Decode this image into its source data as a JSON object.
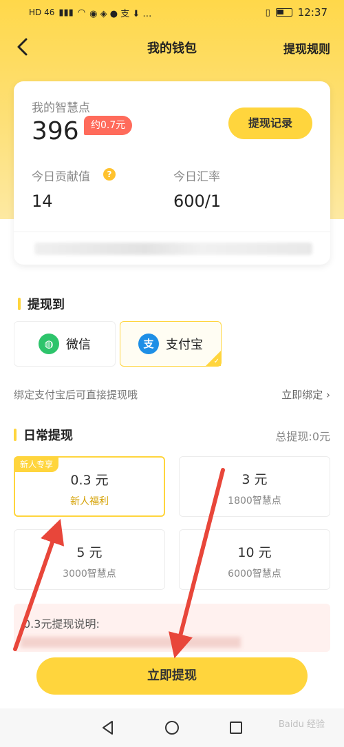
{
  "status_bar": {
    "left_text": "HD 46",
    "time": "12:37"
  },
  "nav": {
    "title": "我的钱包",
    "right_link": "提现规则"
  },
  "card": {
    "points_label": "我的智慧点",
    "points_value": "396",
    "approx_badge": "约0.7元",
    "record_button": "提现记录",
    "contrib_label": "今日贡献值",
    "contrib_value": "14",
    "rate_label": "今日汇率",
    "rate_value": "600/1"
  },
  "withdraw_to": {
    "title": "提现到",
    "options": [
      {
        "label": "微信",
        "icon": "wechat-icon"
      },
      {
        "label": "支付宝",
        "icon": "alipay-icon",
        "selected": true
      }
    ]
  },
  "bind": {
    "hint": "绑定支付宝后可直接提现哦",
    "link": "立即绑定"
  },
  "daily": {
    "title": "日常提现",
    "total": "总提现:0元",
    "amounts": [
      {
        "value": "0.3 元",
        "sub": "新人福利",
        "tag": "新人专享",
        "selected": true
      },
      {
        "value": "3 元",
        "sub": "1800智慧点"
      },
      {
        "value": "5 元",
        "sub": "3000智慧点"
      },
      {
        "value": "10 元",
        "sub": "6000智慧点"
      }
    ]
  },
  "note": {
    "title": "0.3元提现说明:"
  },
  "cta": "立即提现",
  "watermark": "Baidu 经验",
  "colors": {
    "accent": "#ffd53d",
    "badge": "#ff6b5b",
    "arrow": "#e8463a"
  }
}
